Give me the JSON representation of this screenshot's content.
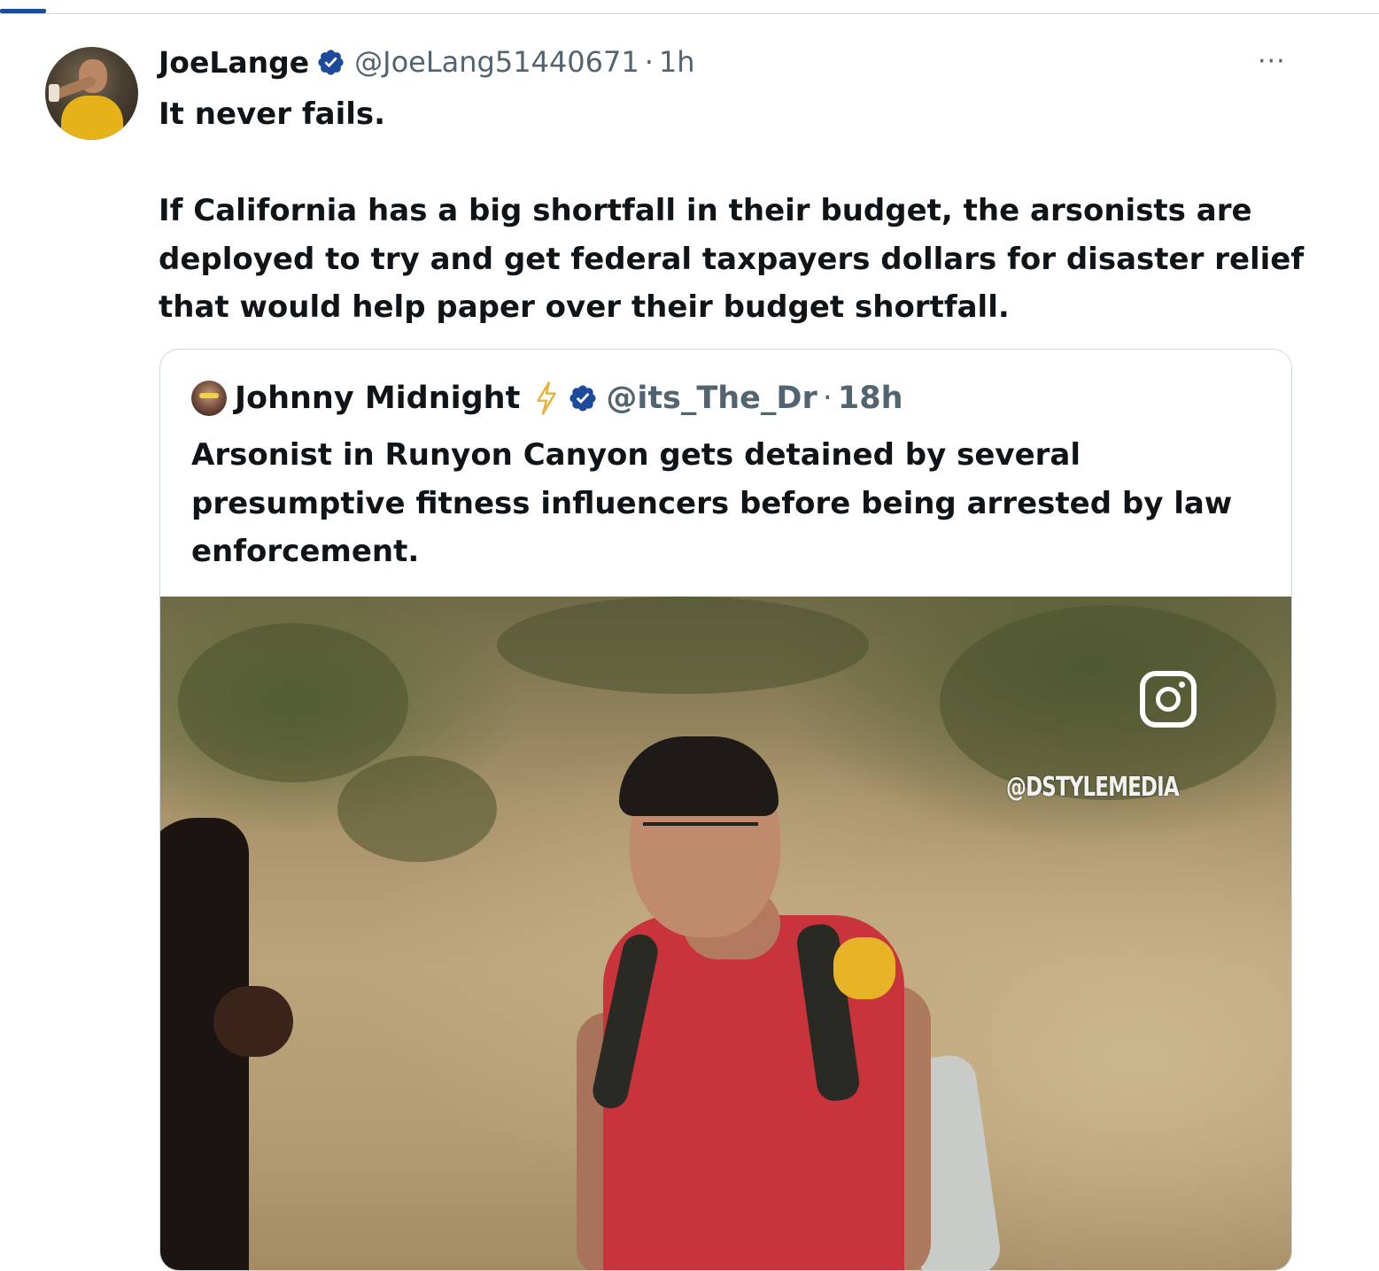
{
  "post": {
    "author_name": "JoeLange",
    "handle": "@JoeLang51440671",
    "separator": "·",
    "time": "1h",
    "more_label": "···",
    "text": "It never fails.\n\nIf California has a big shortfall in their budget, the arsonists are deployed to try and get federal taxpayers dollars for disaster relief that would help paper over their budget shortfall."
  },
  "quoted": {
    "author_name": "Johnny Midnight",
    "handle": "@its_The_Dr",
    "separator": "·",
    "time": "18h",
    "text": "Arsonist in Runyon Canyon gets detained by several presumptive fitness influencers before being arrested by law enforcement.",
    "media": {
      "watermark": "@DSTYLEMEDIA",
      "icon": "instagram-icon"
    }
  },
  "colors": {
    "verified": "#1d4a9b",
    "secondary_text": "#536471",
    "border": "#cfd9de",
    "bolt": "#e8b23a"
  }
}
